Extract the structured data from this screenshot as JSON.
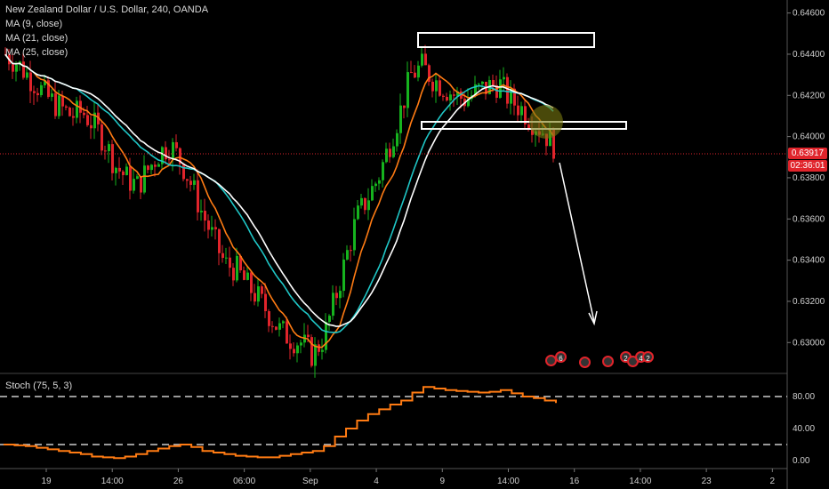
{
  "header": {
    "title": "New Zealand Dollar / U.S. Dollar, 240, OANDA",
    "ma1": "MA (9, close)",
    "ma2": "MA (21, close)",
    "ma3": "MA (25, close)"
  },
  "stoch_label": "Stoch (75, 5, 3)",
  "price_tag": {
    "last": "0.63917",
    "timer": "02:36:01"
  },
  "events": [
    "6",
    "",
    "2",
    "4",
    "2"
  ],
  "colors": {
    "up": "#16b31e",
    "down": "#e0242b",
    "ma9": "#ff7b13",
    "ma21": "#1fc6c6",
    "ma25": "#ffffff",
    "stoch": "#ff7b13"
  },
  "chart_data": {
    "type": "candlestick",
    "title": "New Zealand Dollar / U.S. Dollar, 240, OANDA",
    "ylim": [
      0.6285,
      0.6462
    ],
    "y_ticks": [
      "0.64600",
      "0.64400",
      "0.64200",
      "0.64000",
      "0.63800",
      "0.63600",
      "0.63400",
      "0.63200",
      "0.63000"
    ],
    "x_ticks": [
      "19",
      "14:00",
      "26",
      "06:00",
      "Sep",
      "4",
      "9",
      "14:00",
      "16",
      "14:00",
      "23",
      "2"
    ],
    "price_series": [
      0.644,
      0.6436,
      0.643,
      0.6424,
      0.6418,
      0.6414,
      0.641,
      0.6412,
      0.6406,
      0.6398,
      0.6386,
      0.638,
      0.6376,
      0.6384,
      0.6392,
      0.6396,
      0.6388,
      0.6376,
      0.6362,
      0.635,
      0.6338,
      0.6336,
      0.6328,
      0.6322,
      0.6314,
      0.6306,
      0.6302,
      0.63,
      0.6294,
      0.6302,
      0.632,
      0.634,
      0.636,
      0.637,
      0.638,
      0.6396,
      0.6412,
      0.643,
      0.6434,
      0.6428,
      0.6424,
      0.642,
      0.6418,
      0.6422,
      0.6424,
      0.6426,
      0.6418,
      0.6414,
      0.6408,
      0.6403,
      0.6396
    ],
    "stoch_ylim": [
      -10,
      100
    ],
    "stoch_ticks": [
      "80.00",
      "40.00",
      "0.00"
    ],
    "stoch_levels": [
      80,
      20
    ],
    "stoch_values": [
      20,
      19,
      18,
      16,
      14,
      12,
      10,
      8,
      5,
      4,
      3,
      5,
      8,
      12,
      15,
      18,
      20,
      17,
      12,
      10,
      8,
      6,
      5,
      4,
      4,
      6,
      8,
      10,
      12,
      18,
      30,
      40,
      50,
      58,
      64,
      70,
      75,
      85,
      92,
      90,
      88,
      87,
      86,
      85,
      86,
      88,
      84,
      80,
      78,
      75,
      72
    ]
  }
}
